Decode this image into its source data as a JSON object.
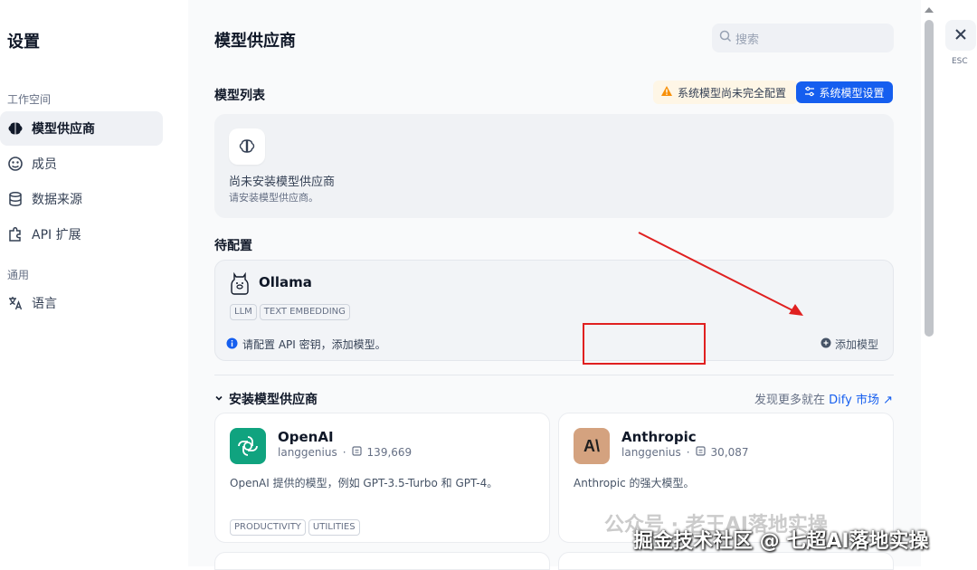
{
  "sidebar": {
    "title": "设置",
    "group_workspace": "工作空间",
    "group_general": "通用",
    "items": [
      {
        "label": "模型供应商",
        "icon": "brain-icon"
      },
      {
        "label": "成员",
        "icon": "members-icon"
      },
      {
        "label": "数据来源",
        "icon": "database-icon"
      },
      {
        "label": "API 扩展",
        "icon": "puzzle-icon"
      },
      {
        "label": "语言",
        "icon": "translate-icon"
      }
    ]
  },
  "main": {
    "title": "模型供应商",
    "search_placeholder": "搜索",
    "model_list_title": "模型列表",
    "warning": "系统模型尚未完全配置",
    "system_settings_button": "系统模型设置",
    "empty_title": "尚未安装模型供应商",
    "empty_desc": "请安装模型供应商。",
    "pending_title": "待配置",
    "ollama": {
      "name": "Ollama",
      "tags": [
        "LLM",
        "TEXT EMBEDDING"
      ],
      "info": "请配置 API 密钥，添加模型。",
      "add_model": "添加模型"
    },
    "install_title": "安装模型供应商",
    "discover_prefix": "发现更多就在",
    "discover_link": "Dify 市场",
    "providers": [
      {
        "name": "OpenAI",
        "author": "langgenius",
        "installs": "139,669",
        "desc": "OpenAI 提供的模型，例如 GPT-3.5-Turbo 和 GPT-4。",
        "tags": [
          "PRODUCTIVITY",
          "UTILITIES"
        ],
        "logo_color": "#10a37f"
      },
      {
        "name": "Anthropic",
        "author": "langgenius",
        "installs": "30,087",
        "desc": "Anthropic 的强大模型。",
        "tags": [],
        "logo_color": "#d4a27f"
      }
    ]
  },
  "close": {
    "esc_label": "ESC"
  },
  "watermark": {
    "line1": "公众号 · 老王AI落地实操",
    "line2": "掘金技术社区 @ 七超AI落地实操"
  }
}
